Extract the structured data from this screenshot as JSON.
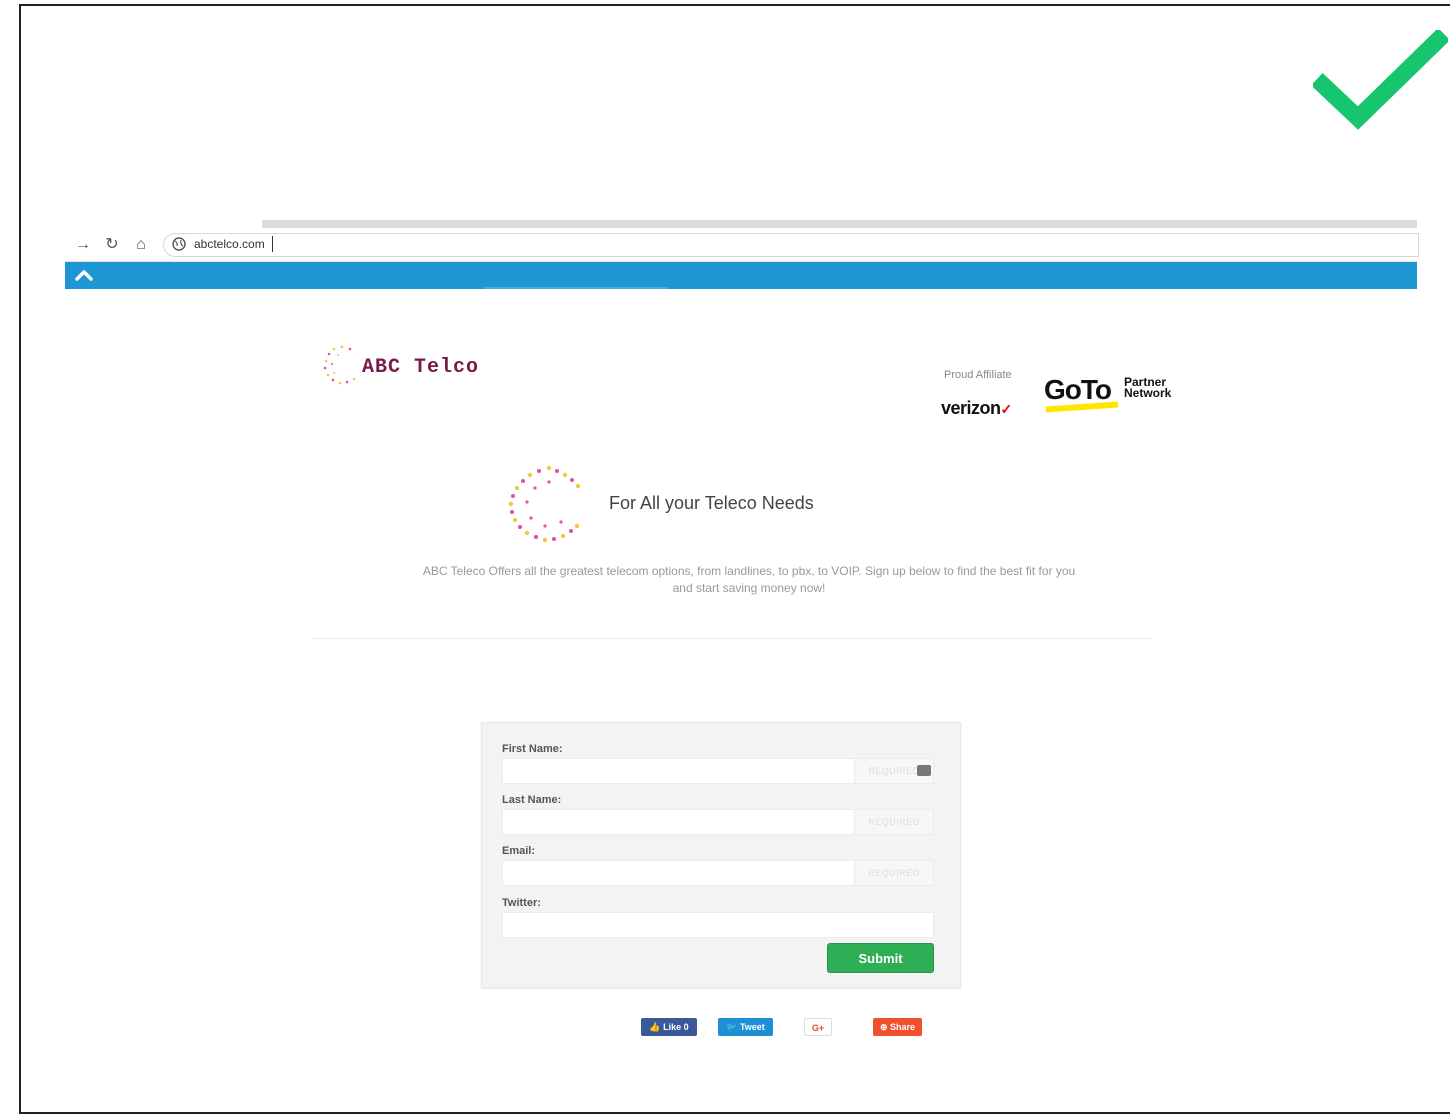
{
  "browser": {
    "url": "abctelco.com"
  },
  "site": {
    "logo_text": "ABC Telco",
    "affiliate_label": "Proud Affiliate",
    "verizon_text": "verizon",
    "goto_text": "GoTo",
    "goto_partner": "Partner Network",
    "hero_title": "For All your Teleco Needs",
    "tagline_line1": "ABC Teleco Offers all the greatest telecom options, from landlines, to pbx, to VOIP.  Sign up below to find the best fit for you",
    "tagline_line2": "and start saving money now!"
  },
  "form": {
    "first_name_label": "First Name:",
    "last_name_label": "Last Name:",
    "email_label": "Email:",
    "twitter_label": "Twitter:",
    "required_text": "REQUIRED",
    "submit_label": "Submit"
  },
  "social": {
    "like": "Like 0",
    "tweet": "Tweet",
    "gplus": "G+",
    "share": "Share"
  },
  "colors": {
    "check": "#17c56e",
    "blue_bar": "#1e96d4",
    "submit": "#2eae55"
  }
}
